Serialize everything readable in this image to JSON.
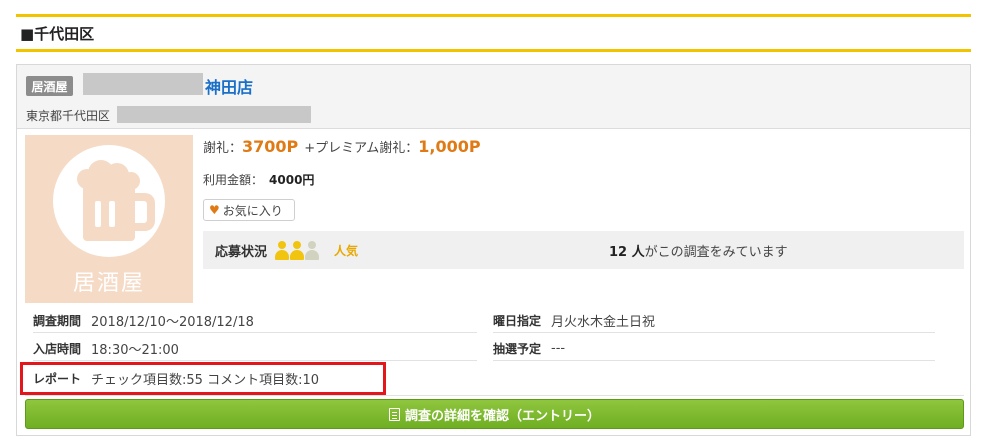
{
  "section": {
    "title": "■千代田区"
  },
  "shop": {
    "genre": "居酒屋",
    "name_suffix": "神田店",
    "address": "東京都千代田区",
    "thumb_label": "居酒屋"
  },
  "reward": {
    "label": "謝礼：",
    "value": "3700P",
    "premium_label": "+プレミアム謝礼：",
    "premium_value": "1,000P"
  },
  "amount": {
    "label": "利用金額：",
    "value": "4000円"
  },
  "favorite_label": "お気に入り",
  "status": {
    "label": "応募状況",
    "popularity": "人気",
    "people_filled": 2,
    "people_total": 3,
    "watch_count": "12 人",
    "watch_text": "がこの調査をみています"
  },
  "details": {
    "period_label": "調査期間",
    "period_value": "2018/12/10〜2018/12/18",
    "weekday_label": "曜日指定",
    "weekday_value": "月火水木金土日祝",
    "time_label": "入店時間",
    "time_value": "18:30〜21:00",
    "lottery_label": "抽選予定",
    "lottery_value": "---",
    "report_label": "レポート",
    "report_value": "チェック項目数:55  コメント項目数:10"
  },
  "entry_button": "調査の詳細を確認（エントリー）",
  "colors": {
    "accent_yellow": "#f2c400",
    "shop_link": "#1a6fc9",
    "reward_orange": "#e07a14",
    "entry_green": "#7ab82e",
    "highlight_red": "#e3161b"
  }
}
